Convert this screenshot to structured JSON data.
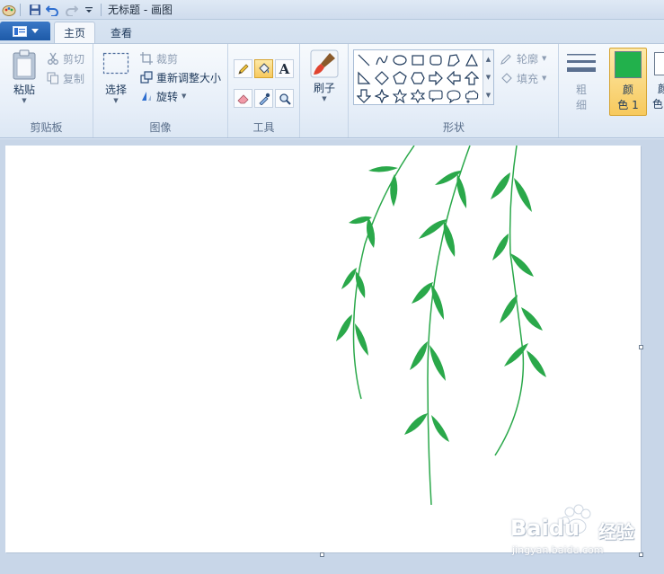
{
  "titlebar": {
    "title": "无标题 - 画图",
    "quick_access": [
      "save-icon",
      "undo-icon",
      "redo-icon",
      "customize-dropdown-icon"
    ]
  },
  "tabs": [
    {
      "label": "主页",
      "active": true
    },
    {
      "label": "查看",
      "active": false
    }
  ],
  "ribbon": {
    "clipboard": {
      "group_label": "剪贴板",
      "paste_label": "粘贴",
      "cut_label": "剪切",
      "copy_label": "复制"
    },
    "image": {
      "group_label": "图像",
      "select_label": "选择",
      "crop_label": "裁剪",
      "resize_label": "重新调整大小",
      "rotate_label": "旋转"
    },
    "tools": {
      "group_label": "工具",
      "items": [
        "pencil-icon",
        "fill-bucket-icon",
        "text-icon",
        "eraser-icon",
        "color-picker-icon",
        "magnifier-icon"
      ],
      "selected": "fill-bucket-icon",
      "text_glyph": "A"
    },
    "brushes": {
      "label": "刷子"
    },
    "shapes": {
      "group_label": "形状",
      "outline_label": "轮廓",
      "fill_label": "填充"
    },
    "size": {
      "label_line1": "粗",
      "label_line2": "细"
    },
    "colors": {
      "color1_line1": "颜",
      "color1_line2": "色 1",
      "color2_line1": "颜",
      "color2_line2": "色",
      "color1_value": "#22b14c",
      "color2_value": "#ffffff"
    }
  },
  "canvas": {
    "background": "#ffffff",
    "leaf_color": "#2aa84a",
    "branch_color": "#2aa84a"
  },
  "watermark": {
    "brand": "Baidu",
    "brand_cn": "经验",
    "url": "jingyan.baidu.com"
  }
}
